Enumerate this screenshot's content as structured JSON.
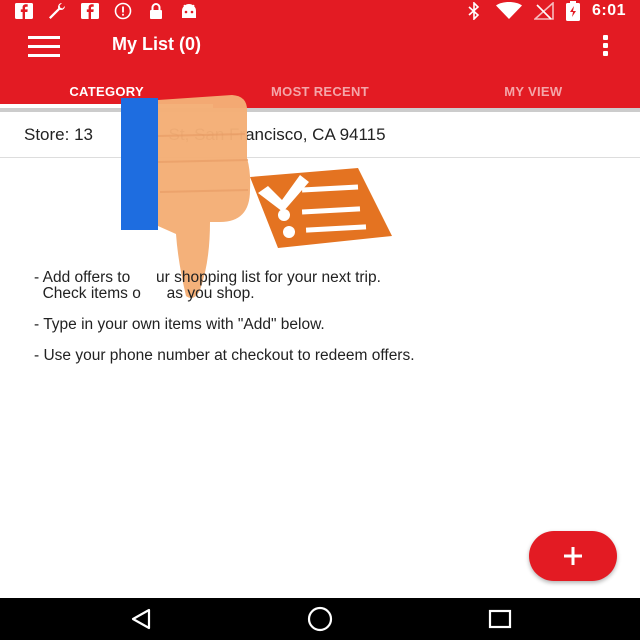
{
  "status_bar": {
    "time": "6:01",
    "left_icons": [
      "facebook-icon",
      "wrench-icon",
      "facebook-icon",
      "alert-icon",
      "lock-icon",
      "android-icon"
    ],
    "right_icons": [
      "bluetooth-icon",
      "wifi-icon",
      "no-signal-icon",
      "battery-icon"
    ]
  },
  "app_bar": {
    "title": "My List (0)",
    "menu_icon": "hamburger-icon",
    "more_icon": "more-vert-icon"
  },
  "tabs": [
    {
      "label": "CATEGORY",
      "active": true
    },
    {
      "label": "MOST RECENT",
      "active": false
    },
    {
      "label": "MY VIEW",
      "active": false
    }
  ],
  "store": {
    "text": "Store: 13                St, San Francisco, CA 94115"
  },
  "instructions": [
    "- Add offers to      ur shopping list for your next trip.\n  Check items o      as you shop.",
    "- Type in your own items with \"Add\" below.",
    "- Use your phone number at checkout to redeem offers."
  ],
  "fab": {
    "icon": "plus-icon"
  },
  "nav_bar": {
    "icons": [
      "back-icon",
      "home-icon",
      "recents-icon"
    ]
  },
  "colors": {
    "brand": "#e31b23",
    "illustration_orange": "#e47321",
    "hand": "#f4ae76",
    "blue": "#1e6de0"
  }
}
